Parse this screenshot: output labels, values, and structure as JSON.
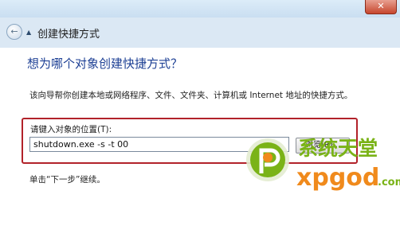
{
  "window": {
    "close_symbol": "✕"
  },
  "header": {
    "back_icon": "back-arrow-icon",
    "title": "创建快捷方式"
  },
  "content": {
    "heading": "想为哪个对象创建快捷方式？",
    "description": "该向导帮你创建本地或网络程序、文件、文件夹、计算机或 Internet 地址的快捷方式。",
    "input_label": "请键入对象的位置(T):",
    "input_value": "shutdown.exe -s -t 00",
    "browse_label": "浏览(R)...",
    "hint": "单击“下一步”继续。"
  },
  "watermark": {
    "name_cn": "系统天堂",
    "domain_text": "xpgod",
    "domain_suffix": ".com"
  },
  "colors": {
    "heading": "#1c3f94",
    "highlight_border": "#b2222a",
    "logo_green": "#7ab317",
    "logo_orange": "#f08a1c"
  }
}
